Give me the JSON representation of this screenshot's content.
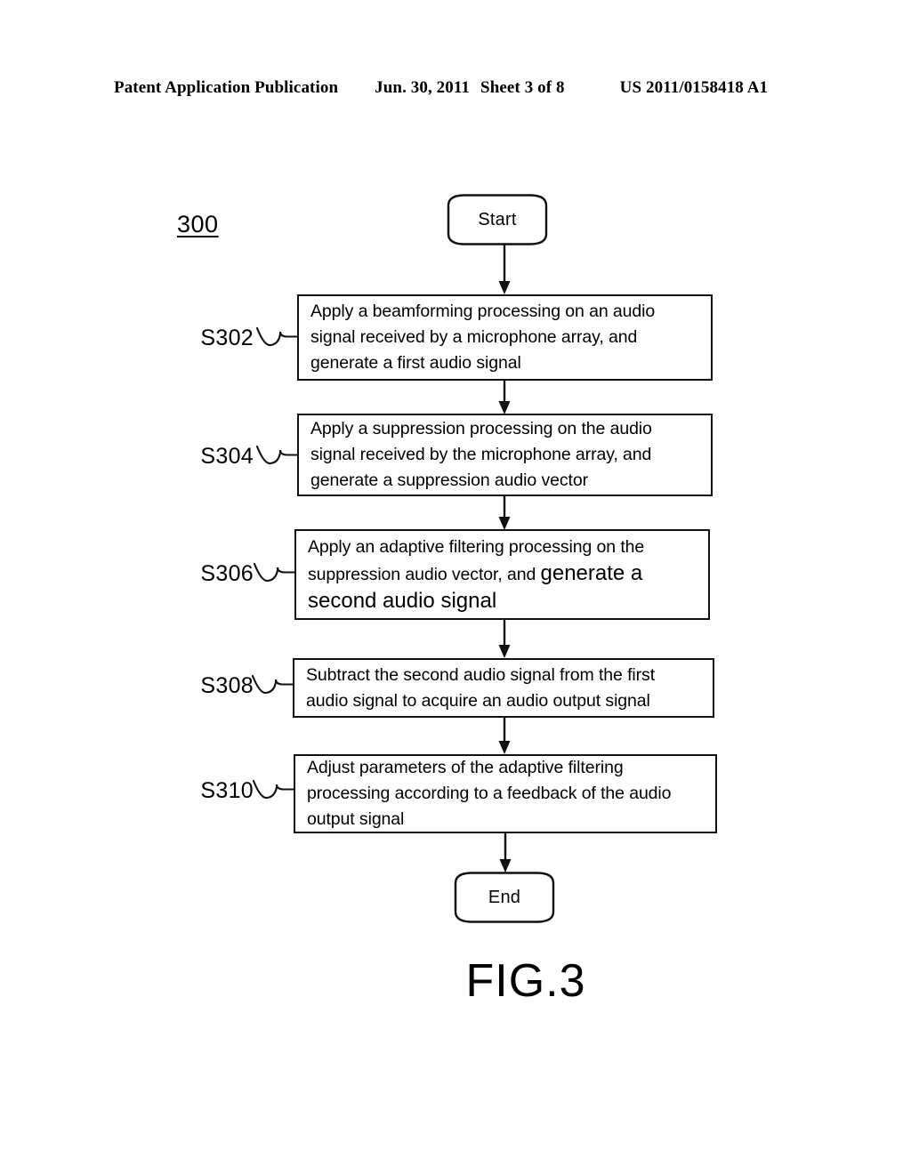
{
  "header": {
    "publication": "Patent Application Publication",
    "date": "Jun. 30, 2011",
    "sheet": "Sheet 3 of 8",
    "patent_number": "US 2011/0158418 A1"
  },
  "figure": {
    "reference_numeral": "300",
    "caption": "FIG.3"
  },
  "flowchart": {
    "start_label": "Start",
    "end_label": "End",
    "steps": [
      {
        "id": "S302",
        "text": "Apply a beamforming processing on an audio signal received by a microphone array, and generate a first audio signal"
      },
      {
        "id": "S304",
        "text": "Apply a suppression processing on the audio signal received by the microphone array, and generate a suppression audio vector"
      },
      {
        "id": "S306",
        "text_normal": "Apply an adaptive filtering processing on the suppression audio vector, and ",
        "text_emphasis": "generate a second audio signal"
      },
      {
        "id": "S308",
        "text": "Subtract the second audio signal from the first audio signal to acquire an audio output signal"
      },
      {
        "id": "S310",
        "text": "Adjust parameters of the adaptive filtering processing according to a feedback of the audio output signal"
      }
    ]
  }
}
